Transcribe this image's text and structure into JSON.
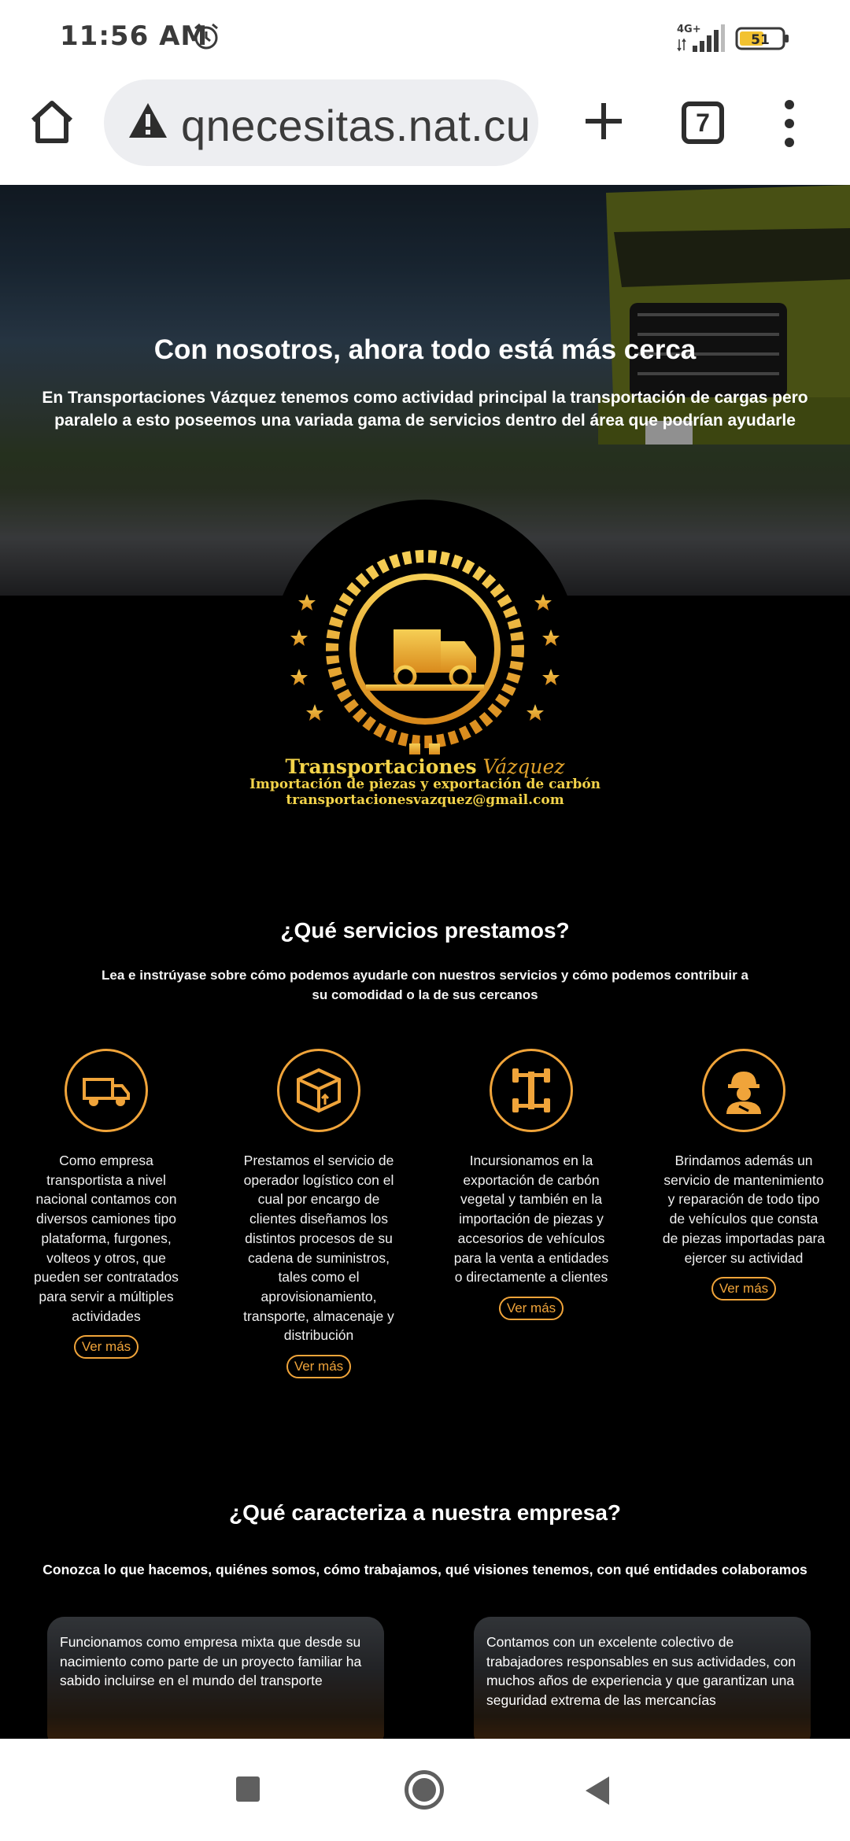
{
  "status_bar": {
    "time": "11:56 AM",
    "network": "4G+",
    "battery": "51"
  },
  "browser": {
    "url": "qnecesitas.nat.cu",
    "tab_count": "7"
  },
  "hero": {
    "title": "Con nosotros, ahora todo está más cerca",
    "text": "En Transportaciones Vázquez tenemos como actividad principal la transportación de cargas pero paralelo a esto poseemos una variada gama de servicios dentro del área que podrían ayudarle"
  },
  "logo": {
    "name_part1": "Transportaciones",
    "name_part2": "Vázquez",
    "tagline": "Importación de piezas y exportación de carbón",
    "email": "transportacionesvazquez@gmail.com"
  },
  "services": {
    "title": "¿Qué servicios prestamos?",
    "subtitle": "Lea e instrúyase sobre cómo podemos ayudarle con nuestros servicios y cómo podemos contribuir a su comodidad o la de sus cercanos",
    "items": [
      {
        "icon": "truck-icon",
        "text": "Como empresa transportista a nivel nacional contamos con diversos camiones tipo plataforma, furgones, volteos y otros, que pueden ser contratados para servir a múltiples actividades",
        "button": "Ver más"
      },
      {
        "icon": "box-icon",
        "text": "Prestamos el servicio de operador logístico con el cual por encargo de clientes diseñamos los distintos procesos de su cadena de suministros, tales como el aprovisionamiento, transporte, almacenaje y distribución",
        "button": "Ver más"
      },
      {
        "icon": "chassis-icon",
        "text": "Incursionamos en la exportación de carbón vegetal y también en la importación de piezas y accesorios de vehículos para la venta a entidades o directamente a clientes",
        "button": "Ver más"
      },
      {
        "icon": "worker-icon",
        "text": "Brindamos además un servicio de mantenimiento y reparación de todo tipo de vehículos que consta de piezas importadas para ejercer su actividad",
        "button": "Ver más"
      }
    ]
  },
  "characteristics": {
    "title": "¿Qué caracteriza a nuestra empresa?",
    "subtitle": "Conozca lo que hacemos, quiénes somos, cómo trabajamos, qué visiones tenemos, con qué entidades colaboramos",
    "cards": [
      {
        "text": "Funcionamos como empresa mixta que desde su nacimiento como parte de un proyecto familiar ha sabido incluirse en el mundo del transporte"
      },
      {
        "text": "Contamos con un excelente colectivo de trabajadores responsables en sus actividades, con muchos años de experiencia y que garantizan una seguridad extrema de las mercancías"
      }
    ]
  },
  "colors": {
    "accent": "#f0a43a",
    "gold": "#f3d34a",
    "background": "#000000"
  }
}
